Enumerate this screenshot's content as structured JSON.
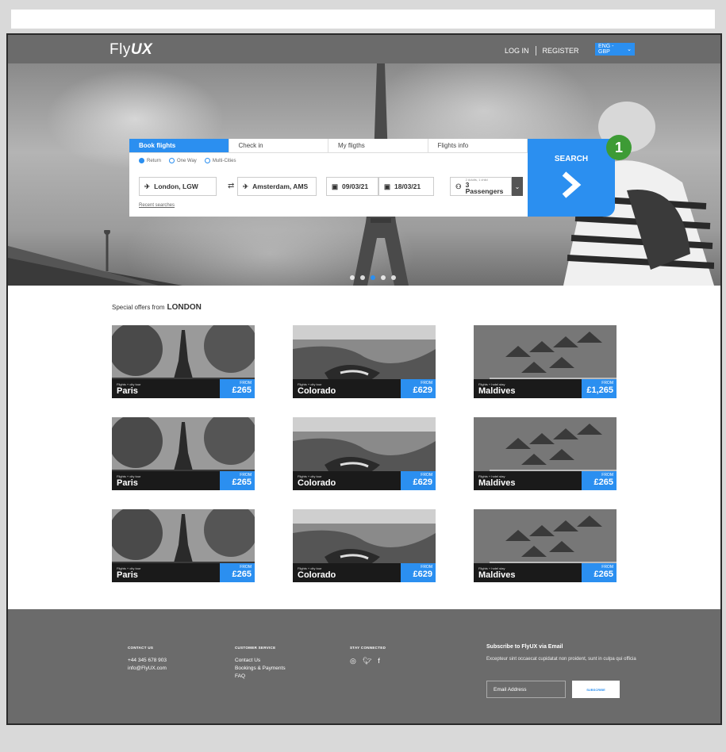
{
  "brand": {
    "logo_light": "Fly",
    "logo_bold": "UX"
  },
  "header": {
    "login": "LOG IN",
    "register": "REGISTER",
    "language": "ENG - GBP"
  },
  "booking": {
    "tabs": [
      "Book flights",
      "Check in",
      "My fligths",
      "Flights info"
    ],
    "trip_types": [
      "Return",
      "One Way",
      "Multi-Cities"
    ],
    "selected_trip_type": "Return",
    "from": "London, LGW",
    "to": "Amsterdam, AMS",
    "depart": "09/03/21",
    "return": "18/03/21",
    "passengers_detail": "2 Adults, 1 child",
    "passengers": "3 Passengers",
    "recent_searches": "Recent searches",
    "search_label": "SEARCH",
    "step_badge": "1"
  },
  "offers": {
    "title_prefix": "Special offers from",
    "title_city": "LONDON",
    "from_label": "FROM",
    "cards": [
      {
        "sub": "Flights + city tour",
        "city": "Paris",
        "price": "£265",
        "scene": "paris"
      },
      {
        "sub": "Flights + city tour",
        "city": "Colorado",
        "price": "£629",
        "scene": "colorado"
      },
      {
        "sub": "Flights + hotel stay",
        "city": "Maldives",
        "price": "£1,265",
        "scene": "maldives"
      },
      {
        "sub": "Flights + city tour",
        "city": "Paris",
        "price": "£265",
        "scene": "paris"
      },
      {
        "sub": "Flights + city tour",
        "city": "Colorado",
        "price": "£629",
        "scene": "colorado"
      },
      {
        "sub": "Flights + hotel stay",
        "city": "Maldives",
        "price": "£265",
        "scene": "maldives"
      },
      {
        "sub": "Flights + city tour",
        "city": "Paris",
        "price": "£265",
        "scene": "paris"
      },
      {
        "sub": "Flights + city tour",
        "city": "Colorado",
        "price": "£629",
        "scene": "colorado"
      },
      {
        "sub": "Flights + hotel stay",
        "city": "Maldives",
        "price": "£265",
        "scene": "maldives"
      }
    ]
  },
  "footer": {
    "contact": {
      "heading": "CONTACT US",
      "phone": "+44 345 678 903",
      "email": "info@FlyUX.com"
    },
    "service": {
      "heading": "CUSTOMER SERVICE",
      "links": [
        "Contact Us",
        "Bookings & Payments",
        "FAQ"
      ]
    },
    "stay": {
      "heading": "STAY CONNECTED",
      "icons": [
        "instagram-icon",
        "twitter-icon",
        "facebook-icon"
      ]
    },
    "subscribe": {
      "heading": "Subscribe to FlyUX via Email",
      "text": "Excepteur sint occaecat cupidatat non proident, sunt in culpa qui officia",
      "placeholder": "Email Address",
      "button": "SUBSCRIBE"
    }
  },
  "colors": {
    "accent": "#2b8ff0",
    "badge": "#3d9b35",
    "header": "#6b6b6b"
  }
}
